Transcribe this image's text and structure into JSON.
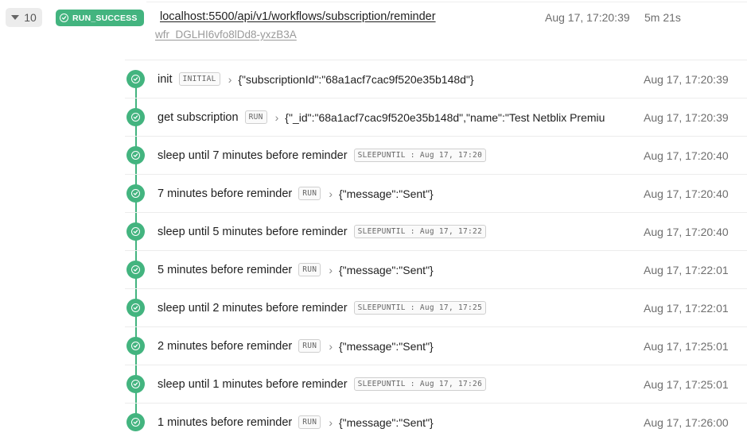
{
  "run": {
    "count": "10",
    "status": "RUN_SUCCESS",
    "url": "localhost:5500/api/v1/workflows/subscription/reminder",
    "id": "wfr_DGLHI6vfo8lDd8-yxzB3A",
    "time": "Aug 17, 17:20:39",
    "duration": "5m 21s"
  },
  "colors": {
    "success": "#43b47f",
    "muted": "#6e6e6e"
  },
  "steps": [
    {
      "name": "init",
      "type": "INITIAL",
      "output": "{\"subscriptionId\":\"68a1acf7cac9f520e35b148d\"}",
      "time": "Aug 17, 17:20:39"
    },
    {
      "name": "get subscription",
      "type": "RUN",
      "output": "{\"_id\":\"68a1acf7cac9f520e35b148d\",\"name\":\"Test Netblix Premiu",
      "time": "Aug 17, 17:20:39"
    },
    {
      "name": "sleep until 7 minutes before reminder",
      "type": "SLEEPUNTIL : Aug 17, 17:20",
      "output": "",
      "time": "Aug 17, 17:20:40"
    },
    {
      "name": "7 minutes before reminder",
      "type": "RUN",
      "output": "{\"message\":\"Sent\"}",
      "time": "Aug 17, 17:20:40"
    },
    {
      "name": "sleep until 5 minutes before reminder",
      "type": "SLEEPUNTIL : Aug 17, 17:22",
      "output": "",
      "time": "Aug 17, 17:20:40"
    },
    {
      "name": "5 minutes before reminder",
      "type": "RUN",
      "output": "{\"message\":\"Sent\"}",
      "time": "Aug 17, 17:22:01"
    },
    {
      "name": "sleep until 2 minutes before reminder",
      "type": "SLEEPUNTIL : Aug 17, 17:25",
      "output": "",
      "time": "Aug 17, 17:22:01"
    },
    {
      "name": "2 minutes before reminder",
      "type": "RUN",
      "output": "{\"message\":\"Sent\"}",
      "time": "Aug 17, 17:25:01"
    },
    {
      "name": "sleep until 1 minutes before reminder",
      "type": "SLEEPUNTIL : Aug 17, 17:26",
      "output": "",
      "time": "Aug 17, 17:25:01"
    },
    {
      "name": "1 minutes before reminder",
      "type": "RUN",
      "output": "{\"message\":\"Sent\"}",
      "time": "Aug 17, 17:26:00"
    }
  ]
}
